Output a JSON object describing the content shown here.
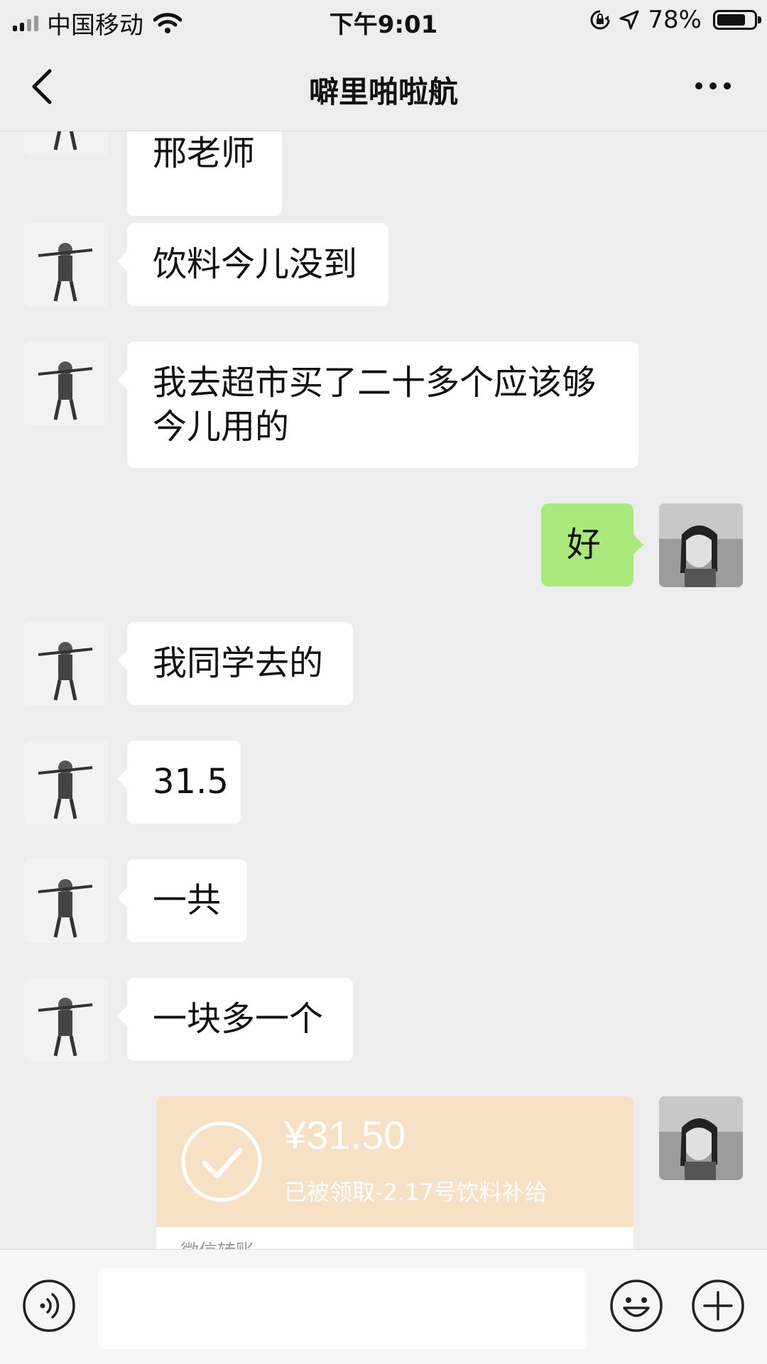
{
  "status_bar": {
    "carrier": "中国移动",
    "time": "下午9:01",
    "battery_percent": "78%",
    "battery_level": 0.78,
    "icons": [
      "signal-icon",
      "wifi-icon",
      "orientation-lock-icon",
      "location-icon",
      "battery-icon"
    ]
  },
  "nav": {
    "title": "噼里啪啦航",
    "back_icon": "chevron-left-icon",
    "more_icon": "more-dots-icon"
  },
  "messages": [
    {
      "side": "left",
      "text": "邢老师"
    },
    {
      "side": "left",
      "text": "饮料今儿没到"
    },
    {
      "side": "left",
      "text": "我去超市买了二十多个应该够今儿用的"
    },
    {
      "side": "right",
      "text": "好"
    },
    {
      "side": "left",
      "text": "我同学去的"
    },
    {
      "side": "left",
      "text": "31.5"
    },
    {
      "side": "left",
      "text": "一共"
    },
    {
      "side": "left",
      "text": "一块多一个"
    }
  ],
  "transfer": {
    "amount": "¥31.50",
    "note": "已被领取-2.17号饮料补给",
    "footer": "微信转账",
    "status_icon": "check-circle-icon",
    "color": "#f7e1c4"
  },
  "input_bar": {
    "placeholder": "",
    "voice_icon": "voice-icon",
    "emoji_icon": "emoji-icon",
    "plus_icon": "plus-icon"
  },
  "colors": {
    "background": "#ededed",
    "sent_bubble": "#a9e87a",
    "received_bubble": "#ffffff"
  }
}
